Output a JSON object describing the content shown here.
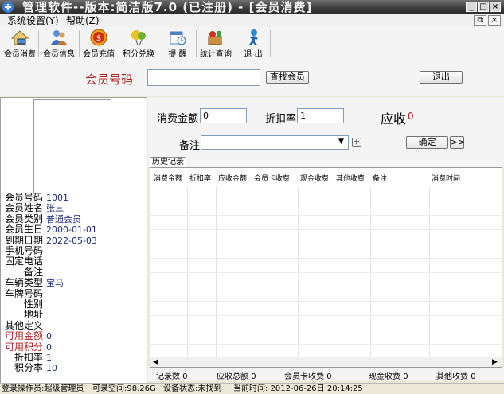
{
  "window": {
    "title": "管理软件--版本:简洁版7.0 (已注册) - [会员消费]"
  },
  "menu": {
    "items": [
      {
        "label": "系统设置(Y)"
      },
      {
        "label": "帮助(Z)"
      }
    ],
    "mdi_restore": "⧉",
    "mdi_close": "×"
  },
  "toolbar": {
    "items": [
      {
        "label": "会员消费",
        "icon": "house-card-icon"
      },
      {
        "label": "会员信息",
        "icon": "users-icon"
      },
      {
        "label": "会员充值",
        "icon": "coin-icon"
      },
      {
        "label": "积分兑换",
        "icon": "balloons-icon"
      },
      {
        "label": "提  醒",
        "icon": "calendar-clock-icon"
      },
      {
        "label": "统计查询",
        "icon": "stats-icon"
      },
      {
        "label": "退  出",
        "icon": "exit-person-icon"
      }
    ]
  },
  "search": {
    "label": "会员号码",
    "value": "",
    "search_button": "查找会员",
    "exit_button": "退出"
  },
  "member": {
    "fields": [
      {
        "label": "会员号码",
        "value": "1001"
      },
      {
        "label": "会员姓名",
        "value": "张三"
      },
      {
        "label": "会员类别",
        "value": "普通会员"
      },
      {
        "label": "会员生日",
        "value": "2000-01-01"
      },
      {
        "label": "到期日期",
        "value": "2022-05-03"
      },
      {
        "label": "手机号码",
        "value": ""
      },
      {
        "label": "固定电话",
        "value": ""
      },
      {
        "label": "备注",
        "value": ""
      },
      {
        "label": "车辆类型",
        "value": "宝马"
      },
      {
        "label": "车牌号码",
        "value": ""
      },
      {
        "label": "性别",
        "value": ""
      },
      {
        "label": "地址",
        "value": ""
      },
      {
        "label": "其他定义",
        "value": ""
      },
      {
        "label": "可用金额",
        "value": "0"
      },
      {
        "label": "可用积分",
        "value": "0"
      },
      {
        "label": "折扣率",
        "value": "1"
      },
      {
        "label": "积分率",
        "value": "10"
      }
    ]
  },
  "consume": {
    "amount_label": "消费金额",
    "amount_value": "0",
    "discount_label": "折扣率",
    "discount_value": "1",
    "receivable_label": "应收",
    "receivable_value": "0",
    "remark_label": "备注",
    "remark_value": "",
    "plus_button": "+",
    "confirm_button": "确定",
    "more_button": ">>"
  },
  "history": {
    "tab_label": "历史记录",
    "columns": [
      "消费金额",
      "折扣率",
      "应收金额",
      "会员卡收费",
      "现金收费",
      "其他收费",
      "备注",
      "消费时间"
    ]
  },
  "summary": [
    {
      "label": "记录数",
      "value": "0"
    },
    {
      "label": "应收总额",
      "value": "0"
    },
    {
      "label": "会员卡收费",
      "value": "0"
    },
    {
      "label": "现金收费",
      "value": "0"
    },
    {
      "label": "其他收费",
      "value": "0"
    }
  ],
  "status": {
    "operator": "登录操作员:超级管理员",
    "space": "可录空间:98.26G",
    "device": "设备状态:未找到",
    "time": "当前时间: 2012-06-26日  20:14:25"
  },
  "colors": {
    "accent_red": "#b22222",
    "value_blue": "#1a2a7a",
    "titlebar": "#3a3a3a"
  }
}
